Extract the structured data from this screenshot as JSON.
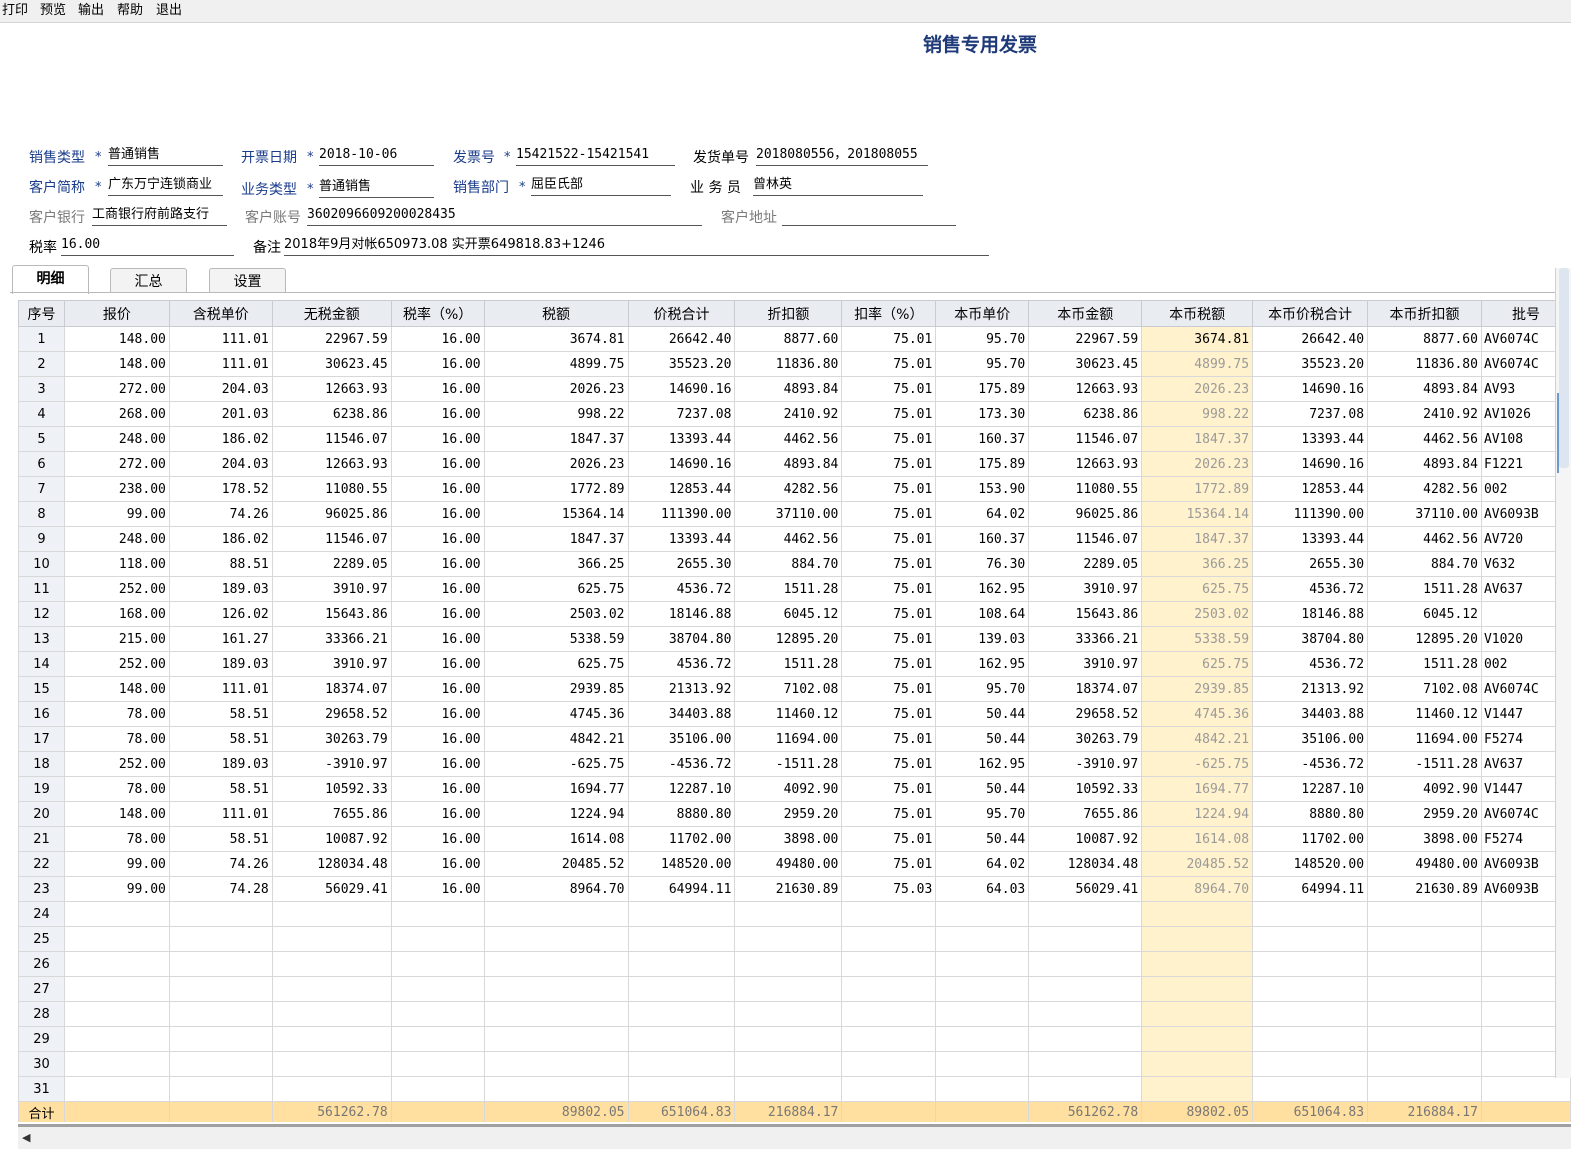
{
  "menu": [
    "打印",
    "预览",
    "输出",
    "帮助",
    "退出"
  ],
  "title": "销售专用发票",
  "header": {
    "sale_type_label": "销售类型",
    "sale_type": "普通销售",
    "invoice_date_label": "开票日期",
    "invoice_date": "2018-10-06",
    "invoice_no_label": "发票号",
    "invoice_no": "15421522-15421541",
    "delivery_no_label": "发货单号",
    "delivery_no": "2018080556，201808055",
    "customer_label": "客户简称",
    "customer": "广东万宁连锁商业",
    "biz_type_label": "业务类型",
    "biz_type": "普通销售",
    "dept_label": "销售部门",
    "dept": "屈臣氏部",
    "salesman_label": "业 务 员",
    "salesman": "曾林英",
    "bank_label": "客户银行",
    "bank": "工商银行府前路支行",
    "account_label": "客户账号",
    "account": "3602096609200028435",
    "address_label": "客户地址",
    "address": "",
    "tax_rate_label": "税率",
    "tax_rate": "16.00",
    "remark_label": "备注",
    "remark": "2018年9月对帐650973.08 实开票649818.83+1246",
    "required_mark": "*"
  },
  "tabs": [
    "明细",
    "汇总",
    "设置"
  ],
  "columns": [
    "序号",
    "报价",
    "含税单价",
    "无税金额",
    "税率（%）",
    "税额",
    "价税合计",
    "折扣额",
    "扣率（%）",
    "本币单价",
    "本币金额",
    "本币税额",
    "本币价税合计",
    "本币折扣额",
    "批号"
  ],
  "rows": [
    [
      "1",
      "148.00",
      "111.01",
      "22967.59",
      "16.00",
      "3674.81",
      "26642.40",
      "8877.60",
      "75.01",
      "95.70",
      "22967.59",
      "3674.81",
      "26642.40",
      "8877.60",
      "AV6074C"
    ],
    [
      "2",
      "148.00",
      "111.01",
      "30623.45",
      "16.00",
      "4899.75",
      "35523.20",
      "11836.80",
      "75.01",
      "95.70",
      "30623.45",
      "4899.75",
      "35523.20",
      "11836.80",
      "AV6074C"
    ],
    [
      "3",
      "272.00",
      "204.03",
      "12663.93",
      "16.00",
      "2026.23",
      "14690.16",
      "4893.84",
      "75.01",
      "175.89",
      "12663.93",
      "2026.23",
      "14690.16",
      "4893.84",
      "AV93"
    ],
    [
      "4",
      "268.00",
      "201.03",
      "6238.86",
      "16.00",
      "998.22",
      "7237.08",
      "2410.92",
      "75.01",
      "173.30",
      "6238.86",
      "998.22",
      "7237.08",
      "2410.92",
      "AV1026"
    ],
    [
      "5",
      "248.00",
      "186.02",
      "11546.07",
      "16.00",
      "1847.37",
      "13393.44",
      "4462.56",
      "75.01",
      "160.37",
      "11546.07",
      "1847.37",
      "13393.44",
      "4462.56",
      "AV108"
    ],
    [
      "6",
      "272.00",
      "204.03",
      "12663.93",
      "16.00",
      "2026.23",
      "14690.16",
      "4893.84",
      "75.01",
      "175.89",
      "12663.93",
      "2026.23",
      "14690.16",
      "4893.84",
      "F1221"
    ],
    [
      "7",
      "238.00",
      "178.52",
      "11080.55",
      "16.00",
      "1772.89",
      "12853.44",
      "4282.56",
      "75.01",
      "153.90",
      "11080.55",
      "1772.89",
      "12853.44",
      "4282.56",
      "002"
    ],
    [
      "8",
      "99.00",
      "74.26",
      "96025.86",
      "16.00",
      "15364.14",
      "111390.00",
      "37110.00",
      "75.01",
      "64.02",
      "96025.86",
      "15364.14",
      "111390.00",
      "37110.00",
      "AV6093B"
    ],
    [
      "9",
      "248.00",
      "186.02",
      "11546.07",
      "16.00",
      "1847.37",
      "13393.44",
      "4462.56",
      "75.01",
      "160.37",
      "11546.07",
      "1847.37",
      "13393.44",
      "4462.56",
      "AV720"
    ],
    [
      "10",
      "118.00",
      "88.51",
      "2289.05",
      "16.00",
      "366.25",
      "2655.30",
      "884.70",
      "75.01",
      "76.30",
      "2289.05",
      "366.25",
      "2655.30",
      "884.70",
      "V632"
    ],
    [
      "11",
      "252.00",
      "189.03",
      "3910.97",
      "16.00",
      "625.75",
      "4536.72",
      "1511.28",
      "75.01",
      "162.95",
      "3910.97",
      "625.75",
      "4536.72",
      "1511.28",
      "AV637"
    ],
    [
      "12",
      "168.00",
      "126.02",
      "15643.86",
      "16.00",
      "2503.02",
      "18146.88",
      "6045.12",
      "75.01",
      "108.64",
      "15643.86",
      "2503.02",
      "18146.88",
      "6045.12",
      ""
    ],
    [
      "13",
      "215.00",
      "161.27",
      "33366.21",
      "16.00",
      "5338.59",
      "38704.80",
      "12895.20",
      "75.01",
      "139.03",
      "33366.21",
      "5338.59",
      "38704.80",
      "12895.20",
      "V1020"
    ],
    [
      "14",
      "252.00",
      "189.03",
      "3910.97",
      "16.00",
      "625.75",
      "4536.72",
      "1511.28",
      "75.01",
      "162.95",
      "3910.97",
      "625.75",
      "4536.72",
      "1511.28",
      "002"
    ],
    [
      "15",
      "148.00",
      "111.01",
      "18374.07",
      "16.00",
      "2939.85",
      "21313.92",
      "7102.08",
      "75.01",
      "95.70",
      "18374.07",
      "2939.85",
      "21313.92",
      "7102.08",
      "AV6074C"
    ],
    [
      "16",
      "78.00",
      "58.51",
      "29658.52",
      "16.00",
      "4745.36",
      "34403.88",
      "11460.12",
      "75.01",
      "50.44",
      "29658.52",
      "4745.36",
      "34403.88",
      "11460.12",
      "V1447"
    ],
    [
      "17",
      "78.00",
      "58.51",
      "30263.79",
      "16.00",
      "4842.21",
      "35106.00",
      "11694.00",
      "75.01",
      "50.44",
      "30263.79",
      "4842.21",
      "35106.00",
      "11694.00",
      "F5274"
    ],
    [
      "18",
      "252.00",
      "189.03",
      "-3910.97",
      "16.00",
      "-625.75",
      "-4536.72",
      "-1511.28",
      "75.01",
      "162.95",
      "-3910.97",
      "-625.75",
      "-4536.72",
      "-1511.28",
      "AV637"
    ],
    [
      "19",
      "78.00",
      "58.51",
      "10592.33",
      "16.00",
      "1694.77",
      "12287.10",
      "4092.90",
      "75.01",
      "50.44",
      "10592.33",
      "1694.77",
      "12287.10",
      "4092.90",
      "V1447"
    ],
    [
      "20",
      "148.00",
      "111.01",
      "7655.86",
      "16.00",
      "1224.94",
      "8880.80",
      "2959.20",
      "75.01",
      "95.70",
      "7655.86",
      "1224.94",
      "8880.80",
      "2959.20",
      "AV6074C"
    ],
    [
      "21",
      "78.00",
      "58.51",
      "10087.92",
      "16.00",
      "1614.08",
      "11702.00",
      "3898.00",
      "75.01",
      "50.44",
      "10087.92",
      "1614.08",
      "11702.00",
      "3898.00",
      "F5274"
    ],
    [
      "22",
      "99.00",
      "74.26",
      "128034.48",
      "16.00",
      "20485.52",
      "148520.00",
      "49480.00",
      "75.01",
      "64.02",
      "128034.48",
      "20485.52",
      "148520.00",
      "49480.00",
      "AV6093B"
    ],
    [
      "23",
      "99.00",
      "74.28",
      "56029.41",
      "16.00",
      "8964.70",
      "64994.11",
      "21630.89",
      "75.03",
      "64.03",
      "56029.41",
      "8964.70",
      "64994.11",
      "21630.89",
      "AV6093B"
    ],
    [
      "24",
      "",
      "",
      "",
      "",
      "",
      "",
      "",
      "",
      "",
      "",
      "",
      "",
      "",
      ""
    ],
    [
      "25",
      "",
      "",
      "",
      "",
      "",
      "",
      "",
      "",
      "",
      "",
      "",
      "",
      "",
      ""
    ],
    [
      "26",
      "",
      "",
      "",
      "",
      "",
      "",
      "",
      "",
      "",
      "",
      "",
      "",
      "",
      ""
    ],
    [
      "27",
      "",
      "",
      "",
      "",
      "",
      "",
      "",
      "",
      "",
      "",
      "",
      "",
      "",
      ""
    ],
    [
      "28",
      "",
      "",
      "",
      "",
      "",
      "",
      "",
      "",
      "",
      "",
      "",
      "",
      "",
      ""
    ],
    [
      "29",
      "",
      "",
      "",
      "",
      "",
      "",
      "",
      "",
      "",
      "",
      "",
      "",
      "",
      ""
    ],
    [
      "30",
      "",
      "",
      "",
      "",
      "",
      "",
      "",
      "",
      "",
      "",
      "",
      "",
      "",
      ""
    ],
    [
      "31",
      "",
      "",
      "",
      "",
      "",
      "",
      "",
      "",
      "",
      "",
      "",
      "",
      "",
      ""
    ]
  ],
  "totals": [
    "合计",
    "",
    "",
    "561262.78",
    "",
    "89802.05",
    "651064.83",
    "216884.17",
    "",
    "",
    "561262.78",
    "89802.05",
    "651064.83",
    "216884.17",
    ""
  ],
  "colors": {
    "highlight": "#fff2cc",
    "total_row": "#ffe0a0",
    "label_blue": "#1a3c8c"
  },
  "icons": {
    "scroll_left": "left-arrow-icon"
  }
}
